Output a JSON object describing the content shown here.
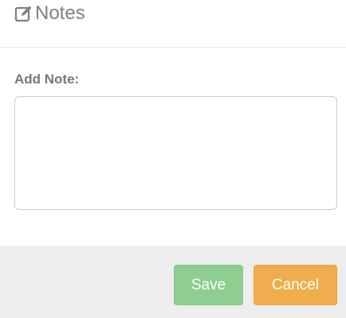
{
  "dialog": {
    "title": "Notes",
    "title_icon": "edit-icon"
  },
  "form": {
    "note_label": "Add Note:",
    "note_value": "",
    "note_placeholder": ""
  },
  "footer": {
    "save_label": "Save",
    "cancel_label": "Cancel",
    "save_color": "#8fce91",
    "cancel_color": "#f0ad4e"
  },
  "colors": {
    "title_text": "#808080",
    "label_text": "#777777",
    "footer_bg": "#eeeeee"
  }
}
